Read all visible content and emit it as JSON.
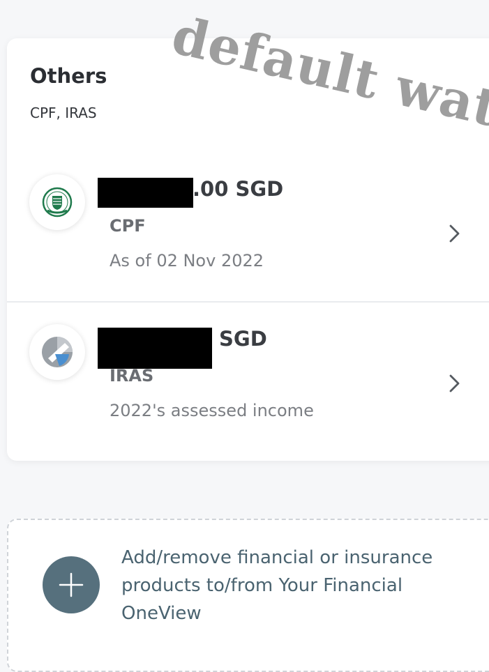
{
  "section": {
    "title": "Others",
    "subtitle": "CPF, IRAS"
  },
  "accounts": [
    {
      "amount_text": ".00 SGD",
      "provider": "CPF",
      "meta": "As of 02 Nov 2022",
      "logo_icon": "cpf-crest-icon",
      "chevron_icon": "chevron-right-icon"
    },
    {
      "amount_text": "SGD",
      "provider": "IRAS",
      "meta": "2022's assessed income",
      "logo_icon": "iras-logo-icon",
      "chevron_icon": "chevron-right-icon"
    }
  ],
  "add_products": {
    "text": "Add/remove financial or insurance products to/from Your Financial OneView",
    "icon": "plus-icon"
  },
  "watermark": {
    "text": "default water"
  },
  "colors": {
    "background": "#f6f7f9",
    "card": "#ffffff",
    "plus_button": "#56707d",
    "add_text": "#4a6370",
    "cpf_green": "#1f7a4c",
    "iras_blue": "#4a8fd0",
    "redaction": "#000000"
  }
}
